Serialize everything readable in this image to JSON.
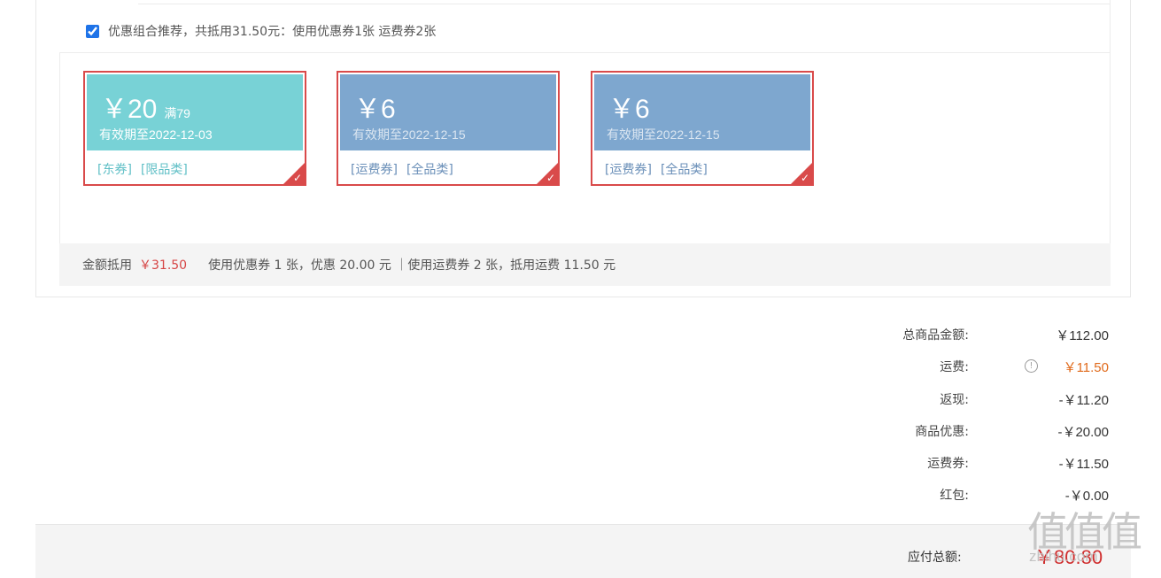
{
  "recommend": {
    "checked": true,
    "text": "优惠组合推荐，共抵用31.50元：使用优惠券1张 运费券2张"
  },
  "coupons": [
    {
      "amount": "￥20",
      "condition": "满79",
      "validity": "有效期至2022-12-03",
      "tags": [
        "[东券]",
        "[限品类]"
      ],
      "header_color": "#78d2d6",
      "validity_color": "#ffffff",
      "tag_color": "#5fbfc6",
      "selected": true
    },
    {
      "amount": "￥6",
      "condition": "",
      "validity": "有效期至2022-12-15",
      "tags": [
        "[运费券]",
        "[全品类]"
      ],
      "header_color": "#7ea7cf",
      "validity_color": "#dbe6f1",
      "tag_color": "#6a8fb8",
      "selected": true
    },
    {
      "amount": "￥6",
      "condition": "",
      "validity": "有效期至2022-12-15",
      "tags": [
        "[运费券]",
        "[全品类]"
      ],
      "header_color": "#7ea7cf",
      "validity_color": "#dbe6f1",
      "tag_color": "#6a8fb8",
      "selected": true
    }
  ],
  "summary": {
    "label": "金额抵用",
    "amount": "￥31.50",
    "detail": "使用优惠券 1 张，优惠 20.00 元 ｜使用运费券 2 张，抵用运费 11.50 元"
  },
  "totals": [
    {
      "label": "总商品金额:",
      "value": "￥112.00",
      "color": "#333333",
      "info": false
    },
    {
      "label": "运费:",
      "value": "￥11.50",
      "color": "#e06a1b",
      "info": true
    },
    {
      "label": "返现:",
      "value": "-￥11.20",
      "color": "#333333",
      "info": false
    },
    {
      "label": "商品优惠:",
      "value": "-￥20.00",
      "color": "#333333",
      "info": false
    },
    {
      "label": "运费券:",
      "value": "-￥11.50",
      "color": "#333333",
      "info": false
    },
    {
      "label": "红包:",
      "value": "-￥0.00",
      "color": "#333333",
      "info": false
    }
  ],
  "payable": {
    "label": "应付总额:",
    "value": "￥80.80"
  },
  "watermark": {
    "logo": "值值值",
    "url": "zhihu.com"
  }
}
